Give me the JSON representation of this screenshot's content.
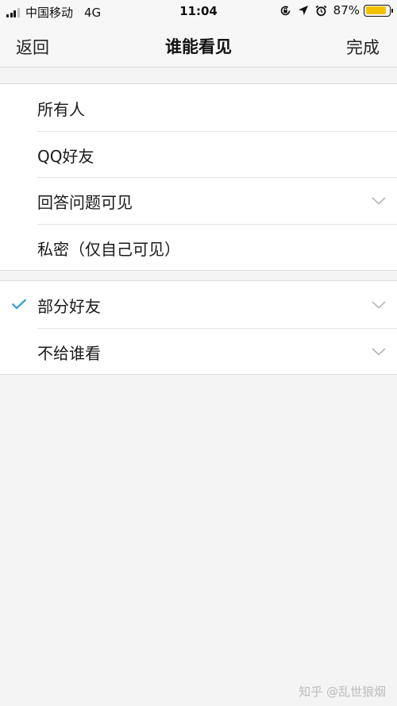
{
  "status_bar": {
    "carrier": "中国移动",
    "network": "4G",
    "time": "11:04",
    "battery": "87%",
    "battery_level": 0.87,
    "battery_color": "#f2c200",
    "icons": [
      "signal-icon",
      "rotation-lock-icon",
      "location-icon",
      "alarm-icon",
      "battery-icon"
    ]
  },
  "nav": {
    "back": "返回",
    "title": "谁能看见",
    "done": "完成"
  },
  "groups": [
    {
      "items": [
        {
          "label": "所有人"
        },
        {
          "label": "QQ好友"
        },
        {
          "label": "回答问题可见",
          "icon": "chevron-down-icon"
        },
        {
          "label": "私密（仅自己可见）"
        }
      ]
    },
    {
      "items": [
        {
          "label": "部分好友",
          "selected": true,
          "icon": "chevron-down-icon"
        },
        {
          "label": "不给谁看",
          "icon": "chevron-down-icon"
        }
      ]
    }
  ],
  "accent_color": "#2e9bd6",
  "watermark": "知乎 @乱世狼烟"
}
